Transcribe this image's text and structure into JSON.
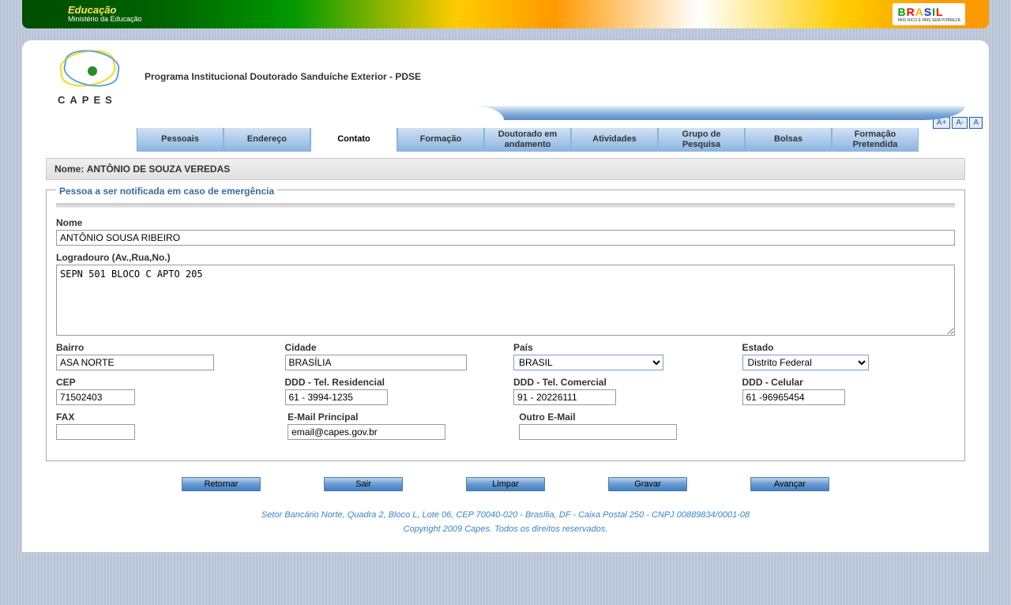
{
  "topBanner": {
    "title": "Educação",
    "subtitle": "Ministério da Educação",
    "brasilSub": "PAÍS RICO É PAÍS SEM POBREZA"
  },
  "header": {
    "capesText": "CAPES",
    "programTitle": "Programa Institucional Doutorado Sanduíche Exterior - PDSE"
  },
  "fontControls": {
    "plus": "A+",
    "minus": "A-",
    "reset": "A"
  },
  "tabs": [
    {
      "label": "Pessoais"
    },
    {
      "label": "Endereço"
    },
    {
      "label": "Contato"
    },
    {
      "label": "Formação"
    },
    {
      "label": "Doutorado em andamento"
    },
    {
      "label": "Atividades"
    },
    {
      "label": "Grupo de Pesquisa"
    },
    {
      "label": "Bolsas"
    },
    {
      "label": "Formação Pretendida"
    }
  ],
  "activeTab": 2,
  "nameBar": {
    "label": "Nome:",
    "value": "ANTÔNIO DE SOUZA VEREDAS"
  },
  "fieldset": {
    "legend": "Pessoa a ser notificada em caso de emergência",
    "fields": {
      "nome": {
        "label": "Nome",
        "value": "ANTÔNIO SOUSA RIBEIRO"
      },
      "logradouro": {
        "label": "Logradouro (Av.,Rua,No.)",
        "value": "SEPN 501 BLOCO C APTO 205"
      },
      "bairro": {
        "label": "Bairro",
        "value": "ASA NORTE"
      },
      "cidade": {
        "label": "Cidade",
        "value": "BRASÍLIA"
      },
      "pais": {
        "label": "País",
        "value": "BRASIL"
      },
      "estado": {
        "label": "Estado",
        "value": "Distrito Federal"
      },
      "cep": {
        "label": "CEP",
        "value": "71502403"
      },
      "telRes": {
        "label": "DDD - Tel. Residencial",
        "value": "61 - 3994-1235"
      },
      "telCom": {
        "label": "DDD - Tel. Comercial",
        "value": "91 - 20226111"
      },
      "cel": {
        "label": "DDD - Celular",
        "value": "61 -96965454"
      },
      "fax": {
        "label": "FAX",
        "value": ""
      },
      "emailPrincipal": {
        "label": "E-Mail Principal",
        "value": "email@capes.gov.br"
      },
      "outroEmail": {
        "label": "Outro E-Mail",
        "value": ""
      }
    }
  },
  "buttons": {
    "retornar": "Retornar",
    "sair": "Sair",
    "limpar": "Limpar",
    "gravar": "Gravar",
    "avancar": "Avançar"
  },
  "footer": {
    "line1": "Setor Bancário Norte, Quadra 2, Bloco L, Lote 06, CEP 70040-020 - Brasília, DF - Caixa Postal 250 - CNPJ 00889834/0001-08",
    "line2": "Copyright 2009 Capes. Todos os direitos reservados."
  }
}
